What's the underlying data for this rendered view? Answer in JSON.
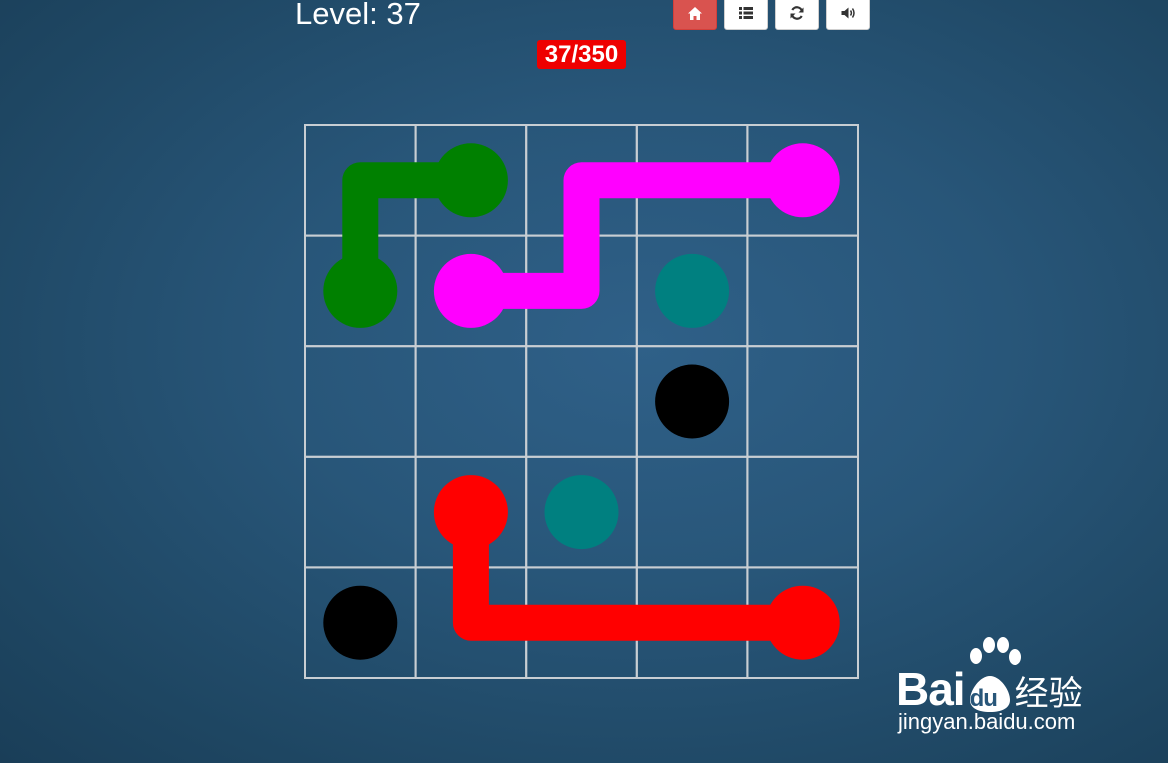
{
  "header": {
    "level_label": "Level: 37",
    "progress_badge": "37/350"
  },
  "toolbar": {
    "buttons": [
      {
        "icon": "home-icon",
        "kind": "home"
      },
      {
        "icon": "list-icon",
        "kind": "list"
      },
      {
        "icon": "refresh-icon",
        "kind": "refresh"
      },
      {
        "icon": "sound-icon",
        "kind": "sound"
      }
    ],
    "home_color": "#d9534f"
  },
  "board": {
    "rows": 5,
    "cols": 5,
    "grid_color": "#c8ced3",
    "dots": [
      {
        "color": "green",
        "hex": "#008000",
        "cells": [
          [
            0,
            1
          ],
          [
            1,
            0
          ]
        ]
      },
      {
        "color": "magenta",
        "hex": "#ff00ff",
        "cells": [
          [
            0,
            4
          ],
          [
            1,
            1
          ]
        ]
      },
      {
        "color": "teal",
        "hex": "#008080",
        "cells": [
          [
            1,
            3
          ],
          [
            3,
            2
          ]
        ]
      },
      {
        "color": "black",
        "hex": "#000000",
        "cells": [
          [
            2,
            3
          ],
          [
            4,
            0
          ]
        ]
      },
      {
        "color": "red",
        "hex": "#ff0000",
        "cells": [
          [
            3,
            1
          ],
          [
            4,
            4
          ]
        ]
      }
    ],
    "paths": [
      {
        "color": "green",
        "hex": "#008000",
        "cells": [
          [
            1,
            0
          ],
          [
            0,
            0
          ],
          [
            0,
            1
          ]
        ]
      },
      {
        "color": "magenta",
        "hex": "#ff00ff",
        "cells": [
          [
            1,
            1
          ],
          [
            1,
            2
          ],
          [
            0,
            2
          ],
          [
            0,
            3
          ],
          [
            0,
            4
          ]
        ]
      },
      {
        "color": "red",
        "hex": "#ff0000",
        "cells": [
          [
            3,
            1
          ],
          [
            4,
            1
          ],
          [
            4,
            2
          ],
          [
            4,
            3
          ],
          [
            4,
            4
          ]
        ]
      }
    ]
  },
  "watermark": {
    "brand_left": "Bai",
    "brand_mid": "du",
    "brand_right": "经验",
    "url": "jingyan.baidu.com"
  }
}
